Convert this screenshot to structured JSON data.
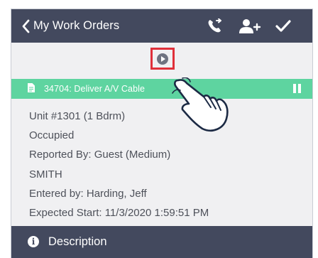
{
  "navbar": {
    "back_label": "My Work Orders",
    "icons": [
      "chevron-left-icon",
      "phone-forward-icon",
      "add-user-icon",
      "checkmark-icon"
    ]
  },
  "timer": {
    "play_icon": "play-circle-icon",
    "highlight_color": "#e0303a"
  },
  "task": {
    "label": "34704: Deliver A/V Cable",
    "icon": "document-icon",
    "status_icon": "pause-icon",
    "color": "#5ed4a0"
  },
  "details": {
    "unit": "Unit #1301 (1 Bdrm)",
    "occupancy": "Occupied",
    "reported_by": "Reported By: Guest  (Medium)",
    "reporter_name": "SMITH",
    "entered_by": "Entered by: Harding, Jeff",
    "expected_start": "Expected Start: 11/3/2020 1:59:51 PM"
  },
  "section": {
    "label": "Description",
    "icon": "info-circle-icon"
  },
  "overlay": {
    "icon": "pointing-hand-icon"
  },
  "colors": {
    "header": "#43495e",
    "background": "#f0f0f2",
    "text": "#4e515a"
  }
}
